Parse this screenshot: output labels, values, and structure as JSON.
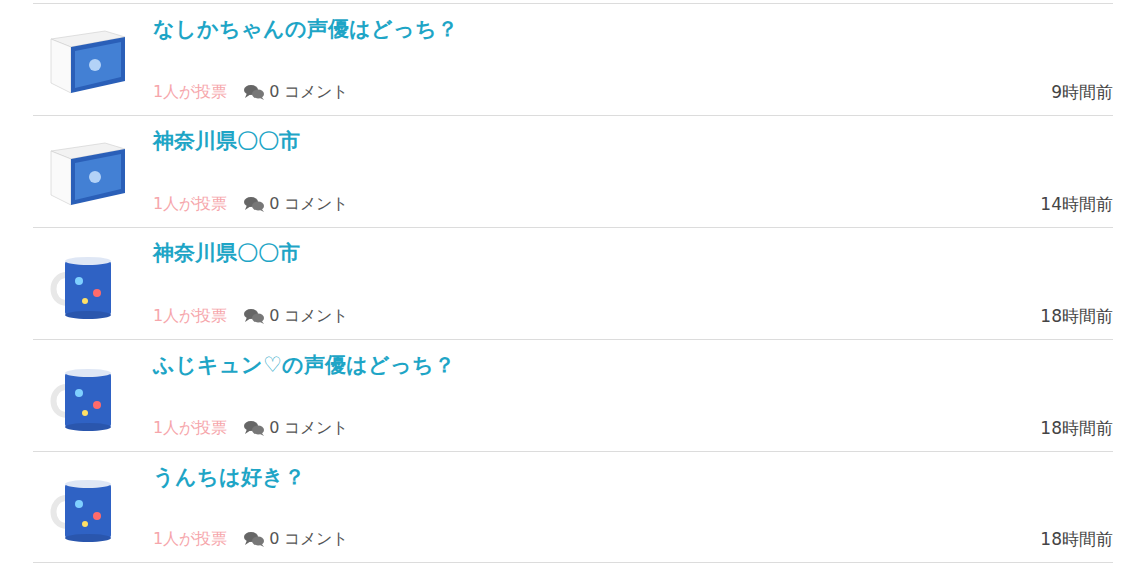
{
  "items": [
    {
      "kind": "box",
      "title": "なしかちゃんの声優はどっち？",
      "votes": "1人が投票",
      "comments": "0 コメント",
      "time": "9時間前"
    },
    {
      "kind": "box",
      "title": "神奈川県〇〇市",
      "votes": "1人が投票",
      "comments": "0 コメント",
      "time": "14時間前"
    },
    {
      "kind": "mug",
      "title": "神奈川県〇〇市",
      "votes": "1人が投票",
      "comments": "0 コメント",
      "time": "18時間前"
    },
    {
      "kind": "mug",
      "title": "ふじキュン♡の声優はどっち？",
      "votes": "1人が投票",
      "comments": "0 コメント",
      "time": "18時間前"
    },
    {
      "kind": "mug",
      "title": "うんちは好き？",
      "votes": "1人が投票",
      "comments": "0 コメント",
      "time": "18時間前"
    }
  ]
}
